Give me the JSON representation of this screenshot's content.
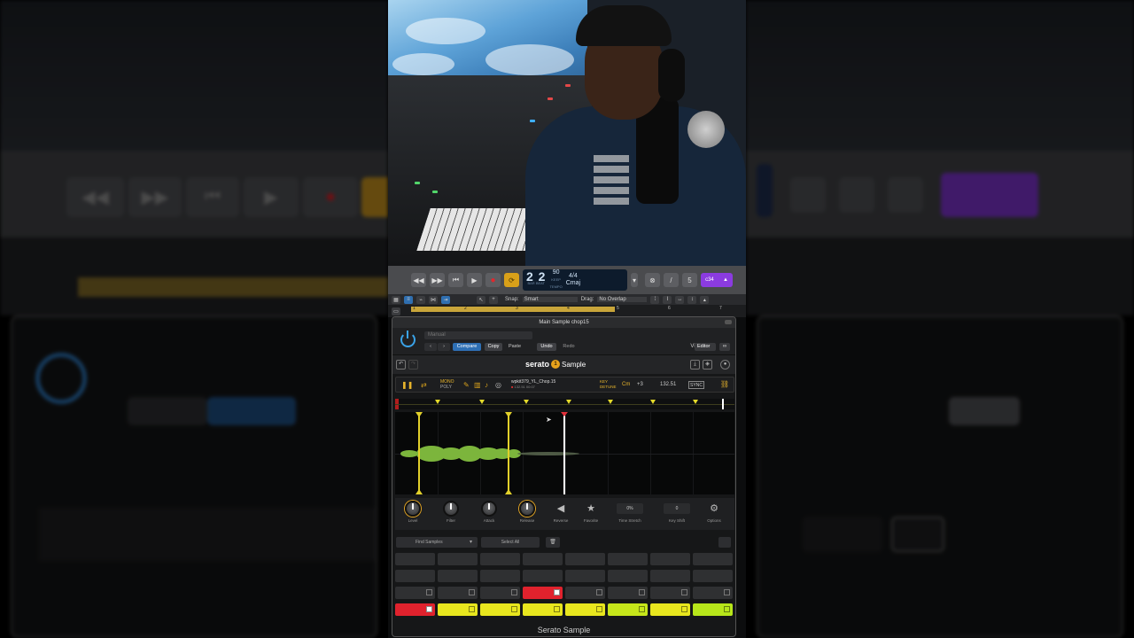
{
  "window": {
    "plugin_title": "Main Sample chop15",
    "footer": "Serato Sample"
  },
  "transport": {
    "position": "2 2",
    "position_sub1": "BAR",
    "position_sub2": "BEAT",
    "tempo": "90",
    "tempo_sub1": "KEEP",
    "tempo_sub2": "TEMPO",
    "signature": "4/4",
    "key": "Cmaj",
    "purple_label": "c34"
  },
  "tools": {
    "snap_label": "Snap:",
    "snap_value": "Smart",
    "drag_label": "Drag:",
    "drag_value": "No Overlap"
  },
  "ruler": {
    "marks": [
      "1",
      "2",
      "3",
      "4",
      "5",
      "6",
      "7"
    ]
  },
  "plugin": {
    "preset": "Manual",
    "compare": "Compare",
    "copy": "Copy",
    "paste": "Paste",
    "undo": "Undo",
    "redo": "Redo",
    "view_label": "View:",
    "view_value": "Editor"
  },
  "brand": {
    "name": "serato",
    "product": "Sample"
  },
  "deck": {
    "mono": "MONO",
    "poly": "POLY",
    "filename": "wpkit379_YL_Chop.15",
    "meta": "132.51  00:07",
    "key_label": "KEY",
    "detune_label": "DETUNE",
    "key_value": "Cm",
    "key_shift": "+3",
    "bpm": "132.51",
    "sync": "SYNC"
  },
  "knobs": [
    {
      "label": "Level"
    },
    {
      "label": "Filter"
    },
    {
      "label": "Attack"
    },
    {
      "label": "Release"
    },
    {
      "label": "Reverse"
    },
    {
      "label": "Favorite"
    },
    {
      "label": "Time Stretch",
      "value": "0%"
    },
    {
      "label": "Key Shift",
      "value": "0"
    },
    {
      "label": "Options"
    }
  ],
  "pad_header": {
    "find": "Find Samples",
    "select_all": "Select All"
  },
  "colors": {
    "accent_blue": "#2e6fb4",
    "brand_orange": "#e7a21c",
    "cue_yellow": "#e4da2a",
    "pad_red": "#e0222d",
    "pad_yellow": "#e8e61e",
    "pad_lime": "#b7e61a",
    "waveform_green": "#7cb53c"
  }
}
